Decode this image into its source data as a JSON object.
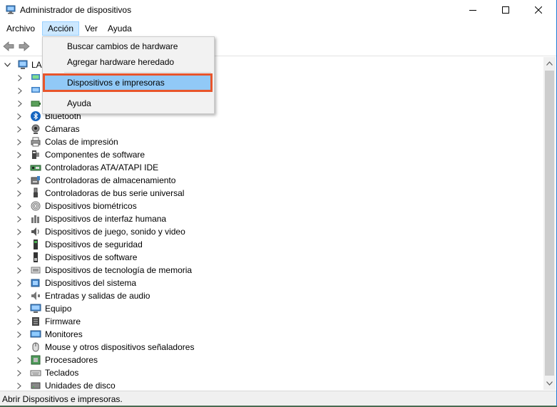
{
  "window": {
    "title": "Administrador de dispositivos",
    "accent": "#1e7cd6"
  },
  "menubar": {
    "items": [
      "Archivo",
      "Acción",
      "Ver",
      "Ayuda"
    ],
    "active_index": 1
  },
  "dropdown": {
    "items": [
      "Buscar cambios de hardware",
      "Agregar hardware heredado",
      "Dispositivos e impresoras",
      "Ayuda"
    ],
    "highlighted_index": 2,
    "highlight_color": "#91c9f7",
    "callout_color": "#e8552b"
  },
  "tree": {
    "root_label": "LA",
    "items": [
      {
        "label": "Bluetooth",
        "icon": "bluetooth-icon"
      },
      {
        "label": "Cámaras",
        "icon": "camera-icon"
      },
      {
        "label": "Colas de impresión",
        "icon": "printer-icon"
      },
      {
        "label": "Componentes de software",
        "icon": "software-component-icon"
      },
      {
        "label": "Controladoras ATA/ATAPI IDE",
        "icon": "ide-controller-icon"
      },
      {
        "label": "Controladoras de almacenamiento",
        "icon": "storage-controller-icon"
      },
      {
        "label": "Controladoras de bus serie universal",
        "icon": "usb-icon"
      },
      {
        "label": "Dispositivos biométricos",
        "icon": "fingerprint-icon"
      },
      {
        "label": "Dispositivos de interfaz humana",
        "icon": "hid-icon"
      },
      {
        "label": "Dispositivos de juego, sonido y video",
        "icon": "speaker-icon"
      },
      {
        "label": "Dispositivos de seguridad",
        "icon": "security-device-icon"
      },
      {
        "label": "Dispositivos de software",
        "icon": "software-device-icon"
      },
      {
        "label": "Dispositivos de tecnología de memoria",
        "icon": "memory-icon"
      },
      {
        "label": "Dispositivos del sistema",
        "icon": "system-device-icon"
      },
      {
        "label": "Entradas y salidas de audio",
        "icon": "audio-io-icon"
      },
      {
        "label": "Equipo",
        "icon": "computer-icon"
      },
      {
        "label": "Firmware",
        "icon": "firmware-icon"
      },
      {
        "label": "Monitores",
        "icon": "monitor-icon"
      },
      {
        "label": "Mouse y otros dispositivos señaladores",
        "icon": "mouse-icon"
      },
      {
        "label": "Procesadores",
        "icon": "processor-icon"
      },
      {
        "label": "Teclados",
        "icon": "keyboard-icon"
      },
      {
        "label": "Unidades de disco",
        "icon": "disk-drive-icon"
      }
    ]
  },
  "status": {
    "text": "Abrir Dispositivos e impresoras."
  }
}
